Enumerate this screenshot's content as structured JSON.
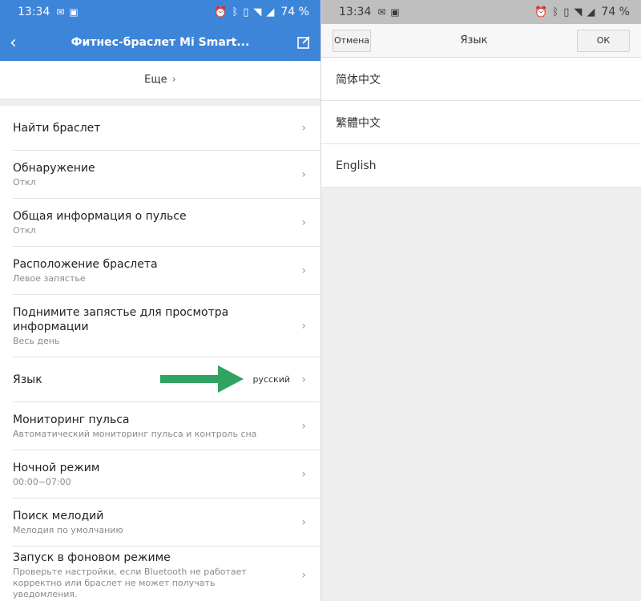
{
  "left": {
    "status": {
      "time": "13:34",
      "battery": "74 %"
    },
    "header": {
      "title": "Фитнес-браслет Mi Smart..."
    },
    "more_label": "Еще",
    "items": [
      {
        "title": "Найти браслет",
        "subtitle": ""
      },
      {
        "title": "Обнаружение",
        "subtitle": "Откл"
      },
      {
        "title": "Общая информация о пульсе",
        "subtitle": "Откл"
      },
      {
        "title": "Расположение браслета",
        "subtitle": "Левое запястье"
      },
      {
        "title": "Поднимите запястье для просмотра информации",
        "subtitle": "Весь день"
      },
      {
        "title": "Язык",
        "value": "русский"
      },
      {
        "title": "Мониторинг пульса",
        "subtitle": "Автоматический мониторинг пульса и контроль сна"
      },
      {
        "title": "Ночной режим",
        "subtitle": "00:00~07:00"
      },
      {
        "title": "Поиск мелодий",
        "subtitle": "Мелодия по умолчанию"
      },
      {
        "title": "Запуск в фоновом режиме",
        "subtitle": "Проверьте настройки, если Bluetooth не работает корректно или браслет не может получать уведомления."
      }
    ],
    "accent_color": "#3d85d8",
    "arrow_color": "#2fa35f"
  },
  "right": {
    "status": {
      "time": "13:34",
      "battery": "74 %"
    },
    "header": {
      "title": "Язык",
      "cancel_label": "Отмена",
      "ok_label": "ОК"
    },
    "languages": [
      "简体中文",
      "繁體中文",
      "English"
    ]
  }
}
